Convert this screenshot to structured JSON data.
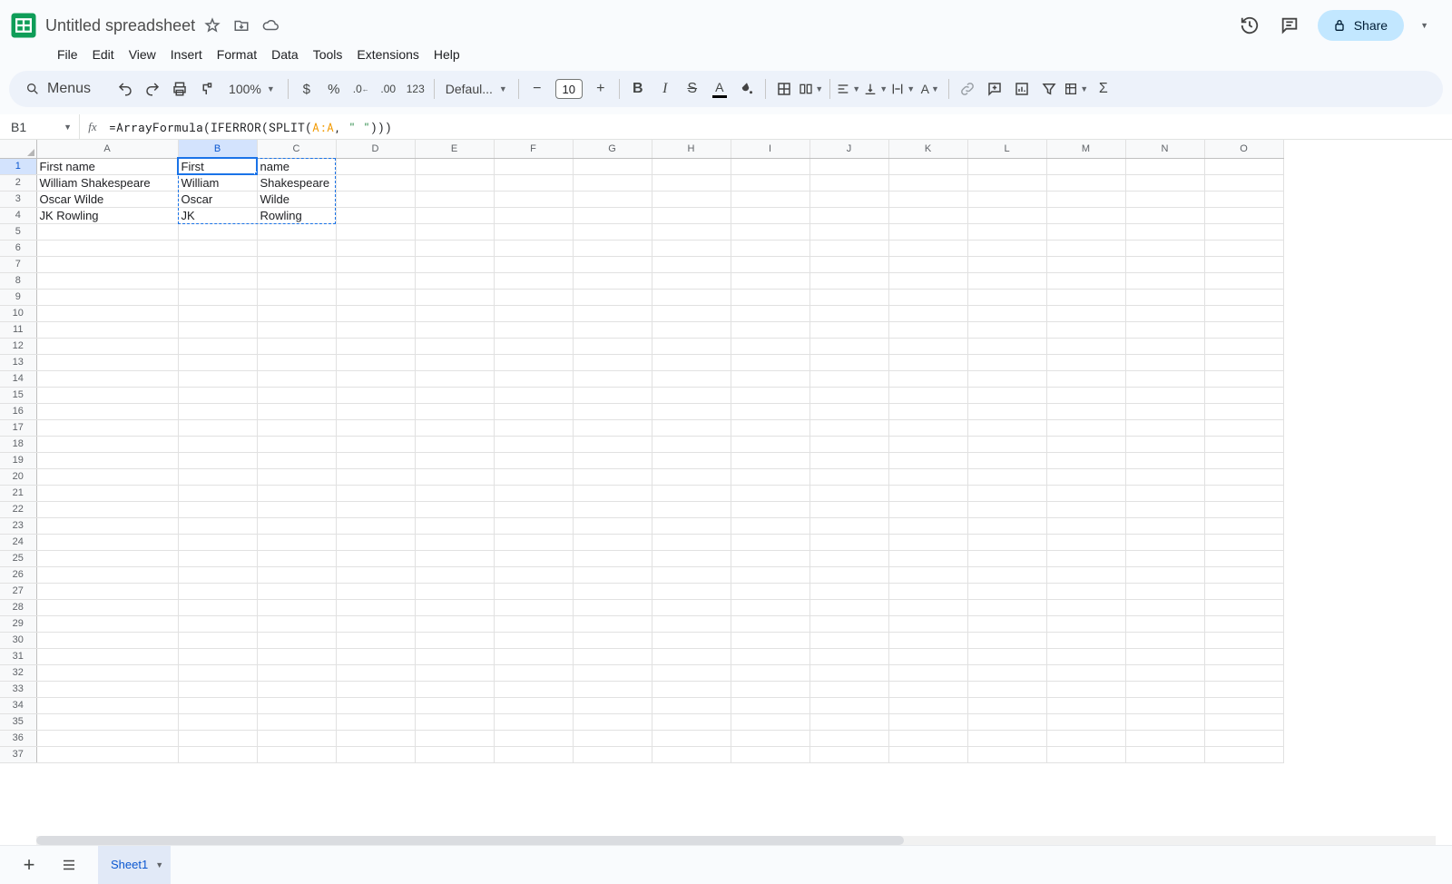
{
  "app": {
    "title": "Untitled spreadsheet"
  },
  "menu": {
    "file": "File",
    "edit": "Edit",
    "view": "View",
    "insert": "Insert",
    "format": "Format",
    "data": "Data",
    "tools": "Tools",
    "extensions": "Extensions",
    "help": "Help"
  },
  "toolbar": {
    "menus_label": "Menus",
    "zoom": "100%",
    "font": "Defaul...",
    "size": "10",
    "currency": "$",
    "percent": "%",
    "fmt123": "123"
  },
  "share": {
    "label": "Share"
  },
  "namebox": {
    "ref": "B1"
  },
  "formula": {
    "prefix": "=ArrayFormula(IFERROR(SPLIT(",
    "ref": "A:A",
    "mid": ", ",
    "lit": "\" \"",
    "suffix": ")))"
  },
  "columns": [
    "A",
    "B",
    "C",
    "D",
    "E",
    "F",
    "G",
    "H",
    "I",
    "J",
    "K",
    "L",
    "M",
    "N",
    "O"
  ],
  "active_col_index": 1,
  "active_row": 1,
  "cells": {
    "r1": {
      "A": "First name",
      "B": "First",
      "C": "name"
    },
    "r2": {
      "A": "William Shakespeare",
      "B": "William",
      "C": "Shakespeare"
    },
    "r3": {
      "A": "Oscar Wilde",
      "B": "Oscar",
      "C": "Wilde"
    },
    "r4": {
      "A": "JK Rowling",
      "B": "JK",
      "C": "Rowling"
    }
  },
  "sheet_tab": {
    "name": "Sheet1"
  }
}
